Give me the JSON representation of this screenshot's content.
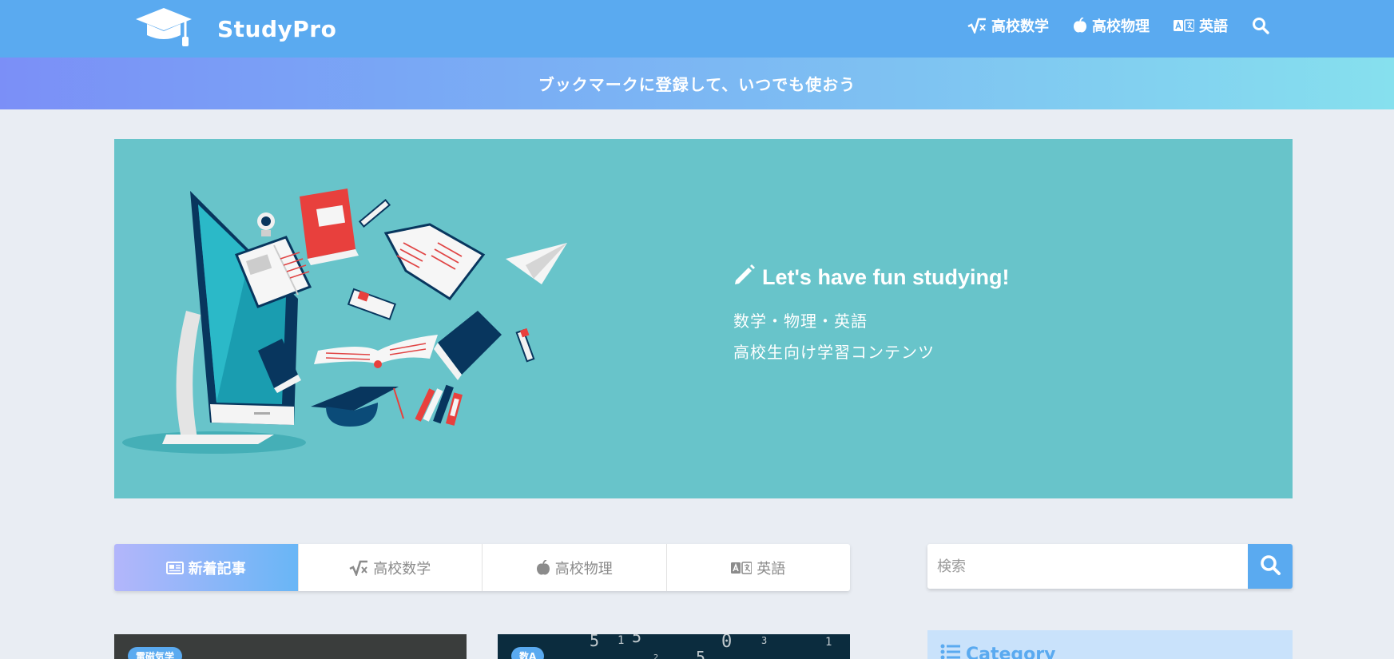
{
  "header": {
    "logo_text": "StudyPro",
    "nav": [
      {
        "label": "高校数学",
        "icon": "sqrt-icon"
      },
      {
        "label": "高校物理",
        "icon": "apple-icon"
      },
      {
        "label": "英語",
        "icon": "language-icon"
      }
    ],
    "search_icon": "search-icon"
  },
  "banner": {
    "text": "ブックマークに登録して、いつでも使おう"
  },
  "hero": {
    "title": "Let's have fun studying!",
    "subtitle_line1": "数学・物理・英語",
    "subtitle_line2": "高校生向け学習コンテンツ"
  },
  "tabs": [
    {
      "label": "新着記事",
      "icon": "newspaper-icon",
      "active": true
    },
    {
      "label": "高校数学",
      "icon": "sqrt-icon",
      "active": false
    },
    {
      "label": "高校物理",
      "icon": "apple-icon",
      "active": false
    },
    {
      "label": "英語",
      "icon": "language-icon",
      "active": false
    }
  ],
  "search": {
    "placeholder": "検索"
  },
  "cards": [
    {
      "badge": "電磁気学"
    },
    {
      "badge": "数A"
    }
  ],
  "sidebar": {
    "category_title": "Category"
  },
  "colors": {
    "header": "#5aaaf0",
    "hero_bg": "#68c4ca",
    "page_bg": "#e9edf3",
    "accent": "#5aaaf0"
  }
}
